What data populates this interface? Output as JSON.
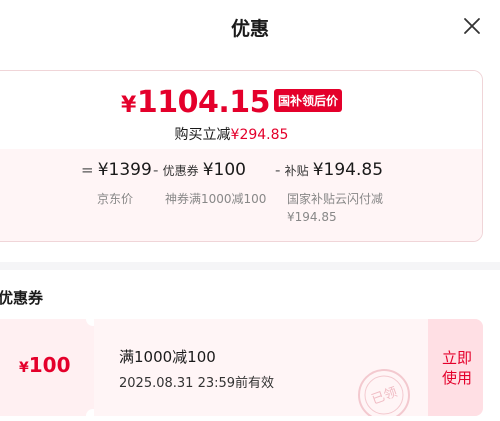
{
  "header": {
    "title": "优惠",
    "close_icon": "close-icon"
  },
  "summary": {
    "final_currency": "¥",
    "final_price": "1104.15",
    "badge": "国补领后价",
    "save_prefix": "购买立减",
    "save_amount": "¥294.85",
    "formula": {
      "eq": "=",
      "base_value": "¥1399",
      "base_desc": "京东价",
      "minus1": "-",
      "coupon_label": "优惠券",
      "coupon_value": "¥100",
      "coupon_desc": "神券满1000减100",
      "minus2": "-",
      "subsidy_label": "补贴",
      "subsidy_value": "¥194.85",
      "subsidy_desc_line1": "国家补贴云闪付减",
      "subsidy_desc_line2": "¥194.85"
    }
  },
  "coupons_section": {
    "title": "优惠券",
    "coupons": [
      {
        "currency": "¥",
        "amount": "100",
        "condition": "满1000减100",
        "expiry": "2025.08.31 23:59前有效",
        "stamp_text": "已领",
        "action_label": "立即使用"
      }
    ]
  },
  "colors": {
    "accent": "#e4002b",
    "badge_bg": "#e4002b",
    "action_bg": "#ffdfe4"
  }
}
